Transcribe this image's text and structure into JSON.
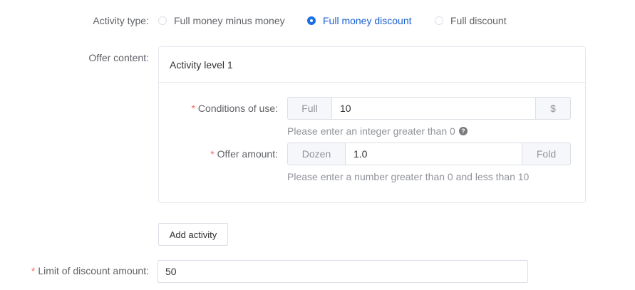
{
  "activity_type": {
    "label": "Activity type:",
    "options": [
      {
        "label": "Full money minus money",
        "checked": false
      },
      {
        "label": "Full money discount",
        "checked": true
      },
      {
        "label": "Full discount",
        "checked": false
      }
    ]
  },
  "offer_content": {
    "label": "Offer content:",
    "level_title": "Activity level 1",
    "conditions": {
      "required_mark": "*",
      "label": "Conditions of use:",
      "prefix": "Full",
      "value": "10",
      "suffix": "$",
      "hint": "Please enter an integer greater than 0",
      "help_icon": "question-circle-icon"
    },
    "offer_amount": {
      "required_mark": "*",
      "label": "Offer amount:",
      "prefix": "Dozen",
      "value": "1.0",
      "suffix": "Fold",
      "hint": "Please enter a number greater than 0 and less than 10"
    }
  },
  "add_activity_button": "Add activity",
  "limit": {
    "required_mark": "*",
    "label": "Limit of discount amount:",
    "value": "50"
  },
  "colors": {
    "accent": "#1a6ee6",
    "required": "#f56c6c",
    "border": "#dcdfe6"
  }
}
